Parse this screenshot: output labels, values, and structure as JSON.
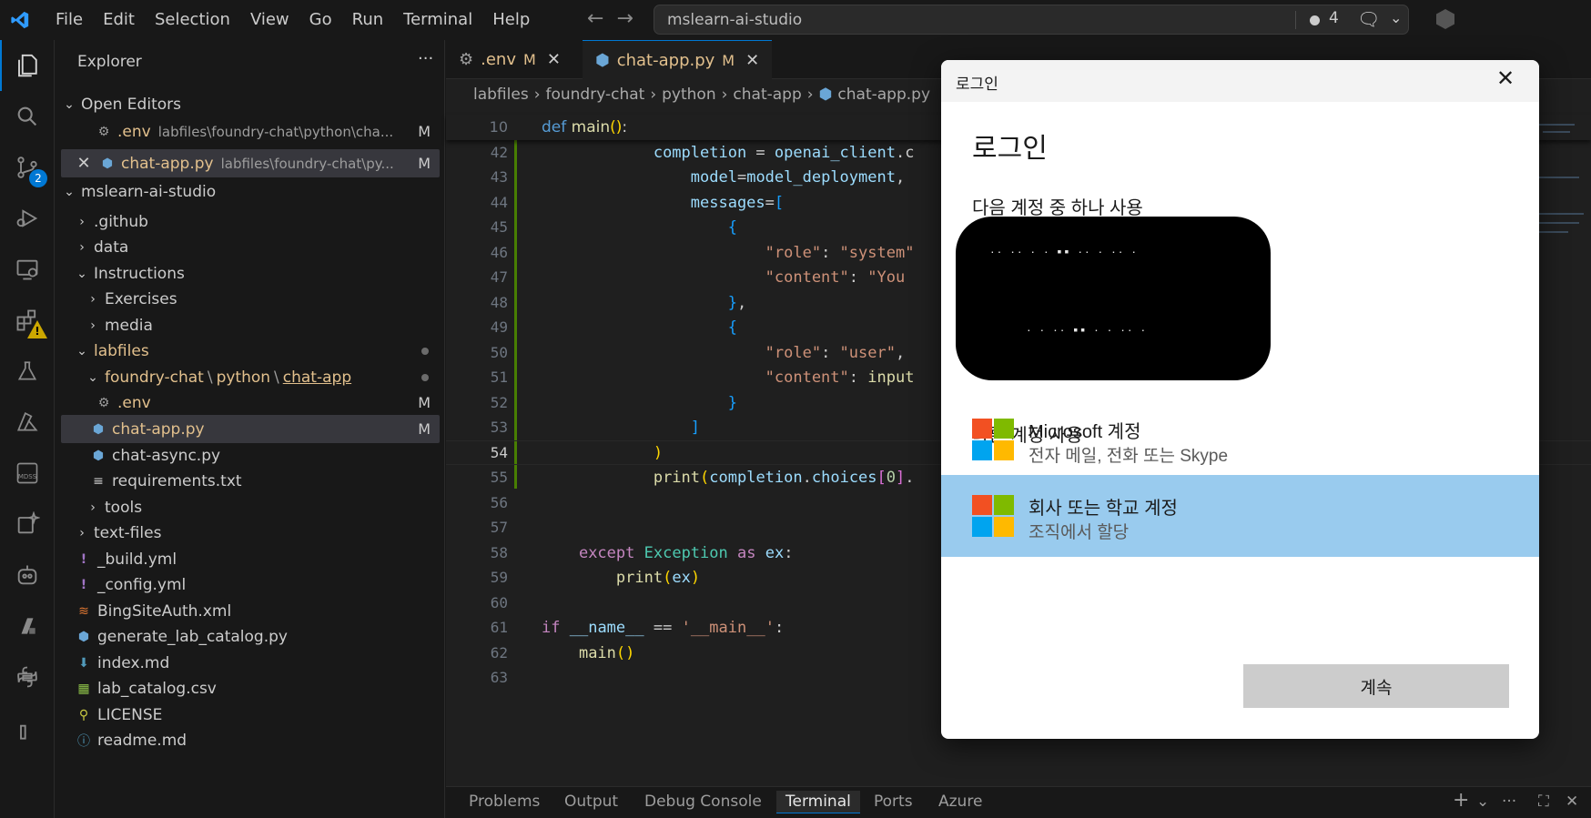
{
  "titlebar": {
    "menu": [
      "File",
      "Edit",
      "Selection",
      "View",
      "Go",
      "Run",
      "Terminal",
      "Help"
    ],
    "search": "mslearn-ai-studio",
    "notification_count": "4"
  },
  "activity": {
    "scm_badge": "2"
  },
  "sidebar": {
    "title": "Explorer",
    "more": "···",
    "open_editors_label": "Open Editors",
    "open_editors": [
      {
        "name": ".env",
        "path": "labfiles\\foundry-chat\\python\\cha...",
        "mark": "M"
      },
      {
        "name": "chat-app.py",
        "path": "labfiles\\foundry-chat\\py...",
        "mark": "M"
      }
    ],
    "workspace_label": "mslearn-ai-studio",
    "tree": {
      "github": ".github",
      "data": "data",
      "instructions": "Instructions",
      "exercises": "Exercises",
      "media": "media",
      "labfiles": "labfiles",
      "foundry_chat": "foundry-chat",
      "python": "python",
      "chat_app_folder": "chat-app",
      "env": ".env",
      "env_mark": "M",
      "chat_app_py": "chat-app.py",
      "chat_app_mark": "M",
      "chat_async": "chat-async.py",
      "requirements": "requirements.txt",
      "tools": "tools",
      "text_files": "text-files",
      "build_yml": "_build.yml",
      "config_yml": "_config.yml",
      "bing": "BingSiteAuth.xml",
      "generate": "generate_lab_catalog.py",
      "index": "index.md",
      "catalog": "lab_catalog.csv",
      "license": "LICENSE",
      "readme": "readme.md"
    }
  },
  "editor": {
    "tabs": [
      {
        "name": ".env",
        "mark": "M"
      },
      {
        "name": "chat-app.py",
        "mark": "M"
      }
    ],
    "breadcrumb": [
      "labfiles",
      "foundry-chat",
      "python",
      "chat-app",
      "chat-app.py"
    ],
    "line_numbers": [
      "10",
      "42",
      "43",
      "44",
      "45",
      "46",
      "47",
      "48",
      "49",
      "50",
      "51",
      "52",
      "53",
      "54",
      "55",
      "56",
      "57",
      "58",
      "59",
      "60",
      "61",
      "62",
      "63"
    ]
  },
  "panel": {
    "tabs": [
      "Problems",
      "Output",
      "Debug Console",
      "Terminal",
      "Ports",
      "Azure"
    ]
  },
  "dialog": {
    "window_title": "로그인",
    "heading": "로그인",
    "use_existing": "다음 계정 중 하나 사용",
    "use_other": "다른 계정 사용",
    "accounts": [
      {
        "name": "Microsoft 계정",
        "desc": "전자 메일, 전화 또는 Skype"
      },
      {
        "name": "회사 또는 학교 계정",
        "desc": "조직에서 할당"
      }
    ],
    "continue": "계속",
    "colors": {
      "highlight": "#99cbee",
      "ms_red": "#f25022",
      "ms_green": "#7fba00",
      "ms_blue": "#00a4ef",
      "ms_yellow": "#ffb900"
    }
  }
}
